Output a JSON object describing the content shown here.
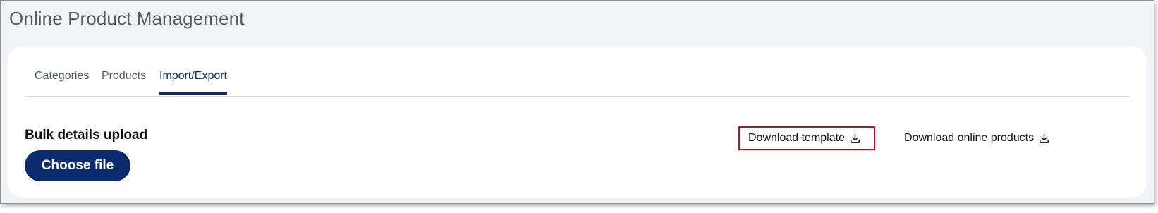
{
  "page": {
    "title": "Online Product Management"
  },
  "tabs": [
    {
      "label": "Categories",
      "active": false
    },
    {
      "label": "Products",
      "active": false
    },
    {
      "label": "Import/Export",
      "active": true
    }
  ],
  "bulk_upload": {
    "title": "Bulk details upload",
    "choose_label": "Choose file"
  },
  "downloads": {
    "template_label": "Download template",
    "online_products_label": "Download online products",
    "icon": "download-icon"
  },
  "colors": {
    "primary": "#0b2a6e",
    "highlight_border": "#e0001b",
    "background": "#f2f3f7"
  }
}
